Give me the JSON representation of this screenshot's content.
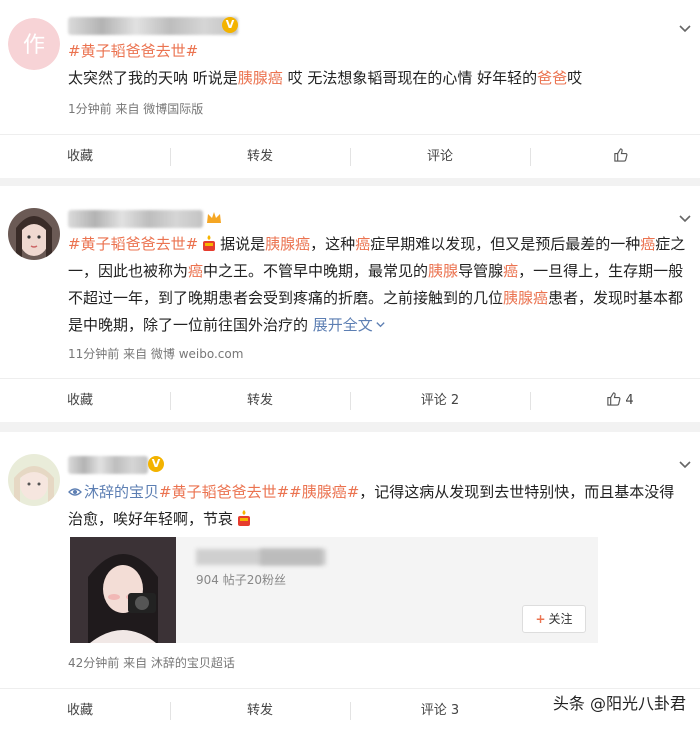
{
  "posts": [
    {
      "hashtag": "#黄子韬爸爸去世#",
      "text": [
        {
          "t": "太突然了我的天呐 听说是",
          "c": ""
        },
        {
          "t": "胰腺癌",
          "c": "hl"
        },
        {
          "t": " 哎 无法想象韬哥现在的心情 好年轻的",
          "c": ""
        },
        {
          "t": "爸爸",
          "c": "hl"
        },
        {
          "t": "哎",
          "c": ""
        }
      ],
      "meta": "1分钟前  来自 微博国际版",
      "actions": {
        "collect": "收藏",
        "repost": "转发",
        "comment": "评论",
        "like": ""
      }
    },
    {
      "text_html_parts": [
        {
          "t": "#黄子韬爸爸去世#",
          "c": "tag"
        },
        {
          "t": "据说是",
          "c": ""
        },
        {
          "t": "胰腺癌",
          "c": "hl"
        },
        {
          "t": "，这种",
          "c": ""
        },
        {
          "t": "癌",
          "c": "hl"
        },
        {
          "t": "症早期难以发现，但又是预后最差的一种",
          "c": ""
        },
        {
          "t": "癌",
          "c": "hl"
        },
        {
          "t": "症之一，因此也被称为",
          "c": ""
        },
        {
          "t": "癌",
          "c": "hl"
        },
        {
          "t": "中之王。不管早中晚期，最常见的",
          "c": ""
        },
        {
          "t": "胰腺",
          "c": "hl"
        },
        {
          "t": "导管腺",
          "c": ""
        },
        {
          "t": "癌",
          "c": "hl"
        },
        {
          "t": "，一旦得上，生存期一般不超过一年，到了晚期患者会受到疼痛的折磨。之前接触到的几位",
          "c": ""
        },
        {
          "t": "胰腺癌",
          "c": "hl"
        },
        {
          "t": "患者，发现时基本都是中晚期，除了一位前往国外治疗的 ",
          "c": ""
        },
        {
          "t": "展开全文",
          "c": "link"
        }
      ],
      "meta": "11分钟前  来自 微博 weibo.com",
      "actions": {
        "collect": "收藏",
        "repost": "转发",
        "comment": "评论 2",
        "like": "4"
      }
    },
    {
      "text_html_parts": [
        {
          "t": "沐辞的宝贝",
          "c": "link"
        },
        {
          "t": "#黄子韬爸爸去世#",
          "c": "tag"
        },
        {
          "t": "#胰腺癌#",
          "c": "tag"
        },
        {
          "t": "，记得这病从发现到去世特别快，而且基本没得治愈，唉好年轻啊，节哀",
          "c": ""
        }
      ],
      "card": {
        "sub": "904 帖子20粉丝",
        "follow": "关注"
      },
      "meta": "42分钟前  来自 沐辞的宝贝超话",
      "actions": {
        "collect": "收藏",
        "repost": "转发",
        "comment": "评论 3",
        "like": ""
      }
    }
  ],
  "watermark": "头条 @阳光八卦君",
  "colors": {
    "accent": "#eb7350",
    "link": "#5d7fb3",
    "verified": "#f3b300"
  }
}
